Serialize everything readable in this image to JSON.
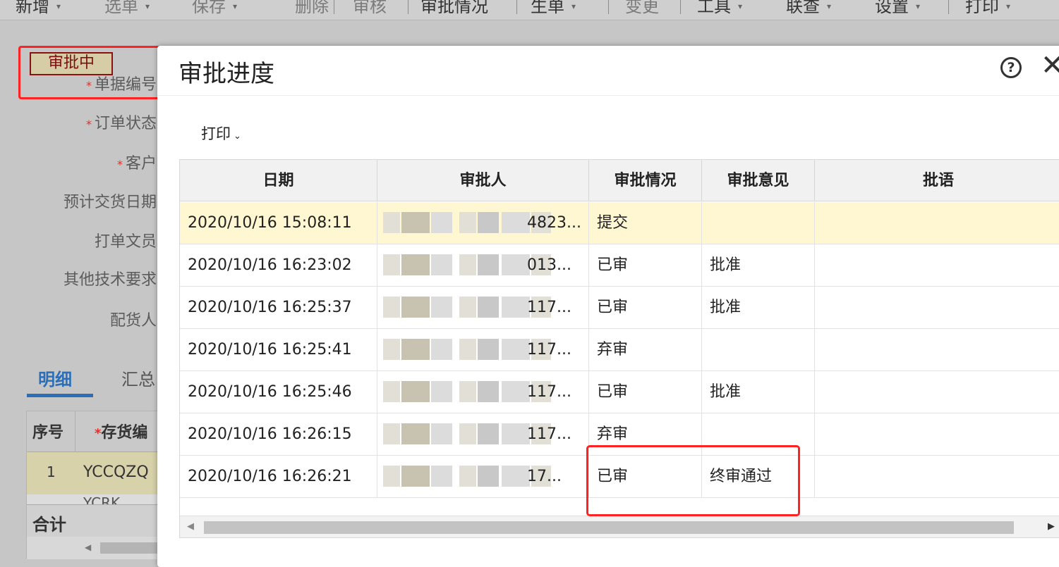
{
  "menubar": [
    {
      "label": "新增",
      "caret": "▾",
      "dim": false
    },
    {
      "label": "选单",
      "caret": "▾",
      "dim": true
    },
    {
      "label": "保存",
      "caret": "▾",
      "dim": true
    },
    {
      "label": "删除",
      "caret": "",
      "dim": true
    },
    {
      "label": "审核",
      "caret": "",
      "dim": true
    },
    {
      "label": "审批情况",
      "caret": "",
      "dim": false
    },
    {
      "label": "生单",
      "caret": "▾",
      "dim": false
    },
    {
      "label": "变更",
      "caret": "",
      "dim": true
    },
    {
      "label": "工具",
      "caret": "▾",
      "dim": false
    },
    {
      "label": "联查",
      "caret": "▾",
      "dim": false
    },
    {
      "label": "设置",
      "caret": "▾",
      "dim": false
    },
    {
      "label": "打印",
      "caret": "▾",
      "dim": false
    }
  ],
  "form": {
    "status_badge": "审批中",
    "labels": [
      {
        "text": "单据编号",
        "required": true
      },
      {
        "text": "订单状态",
        "required": true
      },
      {
        "text": "客户",
        "required": true
      },
      {
        "text": "预计交货日期",
        "required": false
      },
      {
        "text": "打单文员",
        "required": false
      },
      {
        "text": "其他技术要求",
        "required": false
      },
      {
        "text": "配货人",
        "required": false
      }
    ],
    "required_mark": "*",
    "tabs": {
      "active": "明细",
      "other": "汇总"
    },
    "grid": {
      "col_seq": "序号",
      "col_code": "存货编",
      "row1_seq": "1",
      "row1_code": "YCCQZQ",
      "row2_code": "YCRK",
      "footer": "合计"
    }
  },
  "dialog": {
    "title": "审批进度",
    "help_symbol": "?",
    "close_symbol": "✕",
    "toolbar": {
      "print_label": "打印",
      "print_chevron": "⌄"
    },
    "columns": [
      "日期",
      "审批人",
      "审批情况",
      "审批意见",
      "批语"
    ],
    "rows": [
      {
        "date": "2020/10/16 15:08:11",
        "approver_tail": "4823...",
        "status": "提交",
        "opinion": "",
        "remark": "",
        "selected": true
      },
      {
        "date": "2020/10/16 16:23:02",
        "approver_tail": "013...",
        "status": "已审",
        "opinion": "批准",
        "remark": "",
        "selected": false
      },
      {
        "date": "2020/10/16 16:25:37",
        "approver_tail": "117...",
        "status": "已审",
        "opinion": "批准",
        "remark": "",
        "selected": false
      },
      {
        "date": "2020/10/16 16:25:41",
        "approver_tail": "117...",
        "status": "弃审",
        "opinion": "",
        "remark": "",
        "selected": false
      },
      {
        "date": "2020/10/16 16:25:46",
        "approver_tail": "117...",
        "status": "已审",
        "opinion": "批准",
        "remark": "",
        "selected": false
      },
      {
        "date": "2020/10/16 16:26:15",
        "approver_tail": "117...",
        "status": "弃审",
        "opinion": "",
        "remark": "",
        "selected": false
      },
      {
        "date": "2020/10/16 16:26:21",
        "approver_tail": "17...",
        "status": "已审",
        "opinion": "终审通过",
        "remark": "",
        "selected": false
      }
    ],
    "scroll_left": "◀",
    "scroll_right": "▶"
  },
  "colors": {
    "highlight_red": "#ff2222",
    "selected_row": "#fff6d2",
    "tab_blue": "#2b6fb8"
  }
}
